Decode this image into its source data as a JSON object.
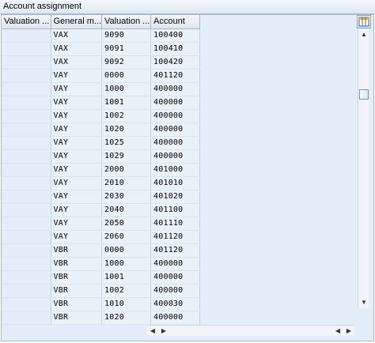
{
  "window": {
    "title": "Account assignment"
  },
  "table": {
    "headers": [
      "Valuation ...",
      "General m...",
      "Valuation ...",
      "Account"
    ],
    "rows": [
      [
        "",
        "VAX",
        "9090",
        "100400"
      ],
      [
        "",
        "VAX",
        "9091",
        "100410"
      ],
      [
        "",
        "VAX",
        "9092",
        "100420"
      ],
      [
        "",
        "VAY",
        "0000",
        "401120"
      ],
      [
        "",
        "VAY",
        "1000",
        "400000"
      ],
      [
        "",
        "VAY",
        "1001",
        "400000"
      ],
      [
        "",
        "VAY",
        "1002",
        "400000"
      ],
      [
        "",
        "VAY",
        "1020",
        "400000"
      ],
      [
        "",
        "VAY",
        "1025",
        "400000"
      ],
      [
        "",
        "VAY",
        "1029",
        "400000"
      ],
      [
        "",
        "VAY",
        "2000",
        "401000"
      ],
      [
        "",
        "VAY",
        "2010",
        "401010"
      ],
      [
        "",
        "VAY",
        "2030",
        "401020"
      ],
      [
        "",
        "VAY",
        "2040",
        "401100"
      ],
      [
        "",
        "VAY",
        "2050",
        "401110"
      ],
      [
        "",
        "VAY",
        "2060",
        "401120"
      ],
      [
        "",
        "VBR",
        "0000",
        "401120"
      ],
      [
        "",
        "VBR",
        "1000",
        "400000"
      ],
      [
        "",
        "VBR",
        "1001",
        "400000"
      ],
      [
        "",
        "VBR",
        "1002",
        "400000"
      ],
      [
        "",
        "VBR",
        "1010",
        "400030"
      ],
      [
        "",
        "VBR",
        "1020",
        "400000"
      ]
    ]
  },
  "icons": {
    "column_settings": "table-settings-icon",
    "scroll_up": "▲",
    "scroll_down": "▼",
    "scroll_left": "◀",
    "scroll_right": "▶"
  },
  "colors": {
    "grid_background": "#e4eef8",
    "header_background": "#dfe6ee",
    "border": "#a8b9ca"
  }
}
